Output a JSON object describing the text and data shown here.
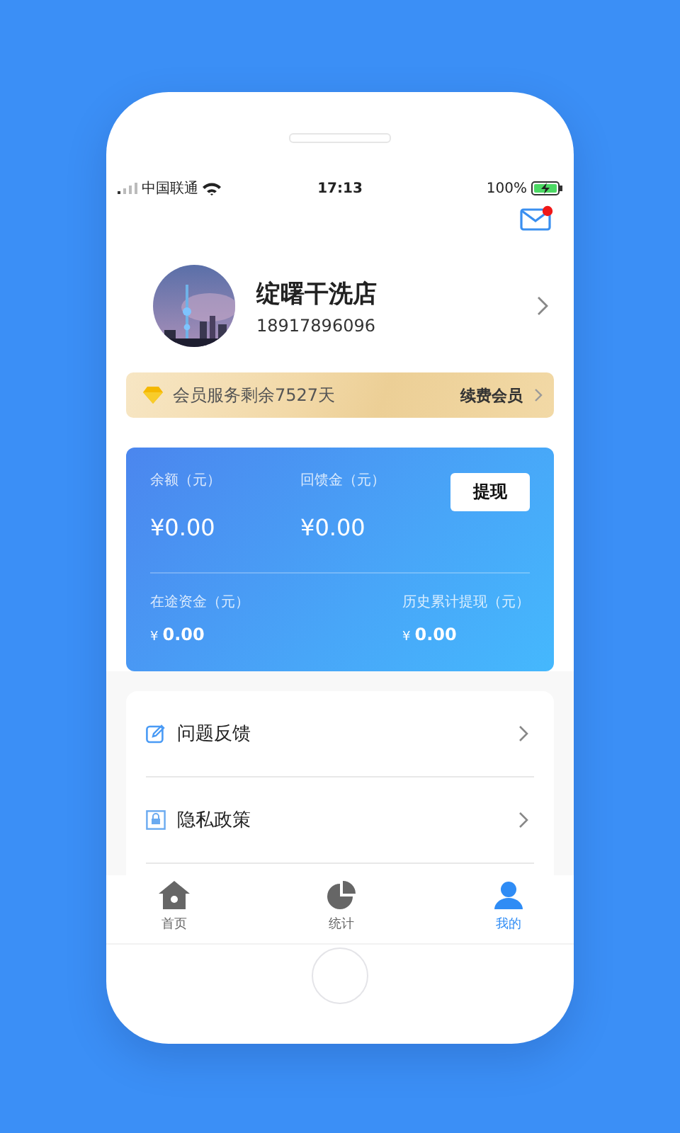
{
  "status_bar": {
    "carrier": "中国联通",
    "time": "17:13",
    "battery": "100%"
  },
  "mail": {
    "unread": true
  },
  "profile": {
    "name": "绽曙干洗店",
    "phone": "18917896096"
  },
  "membership": {
    "text": "会员服务剩余7527天",
    "action": "续费会员"
  },
  "wallet": {
    "button": "提现",
    "top": [
      {
        "label": "余额（元）",
        "value": "¥0.00"
      },
      {
        "label": "回馈金（元）",
        "value": "¥0.00"
      }
    ],
    "bottom": [
      {
        "label": "在途资金（元）",
        "currency": "¥",
        "value": "0.00"
      },
      {
        "label": "历史累计提现（元）",
        "currency": "¥",
        "value": "0.00"
      }
    ]
  },
  "menu": [
    {
      "kind": "feedback",
      "label": "问题反馈"
    },
    {
      "kind": "privacy",
      "label": "隐私政策"
    }
  ],
  "tabs": [
    {
      "kind": "home",
      "label": "首页",
      "selected": false
    },
    {
      "kind": "stats",
      "label": "统计",
      "selected": false
    },
    {
      "kind": "me",
      "label": "我的",
      "selected": true
    }
  ]
}
